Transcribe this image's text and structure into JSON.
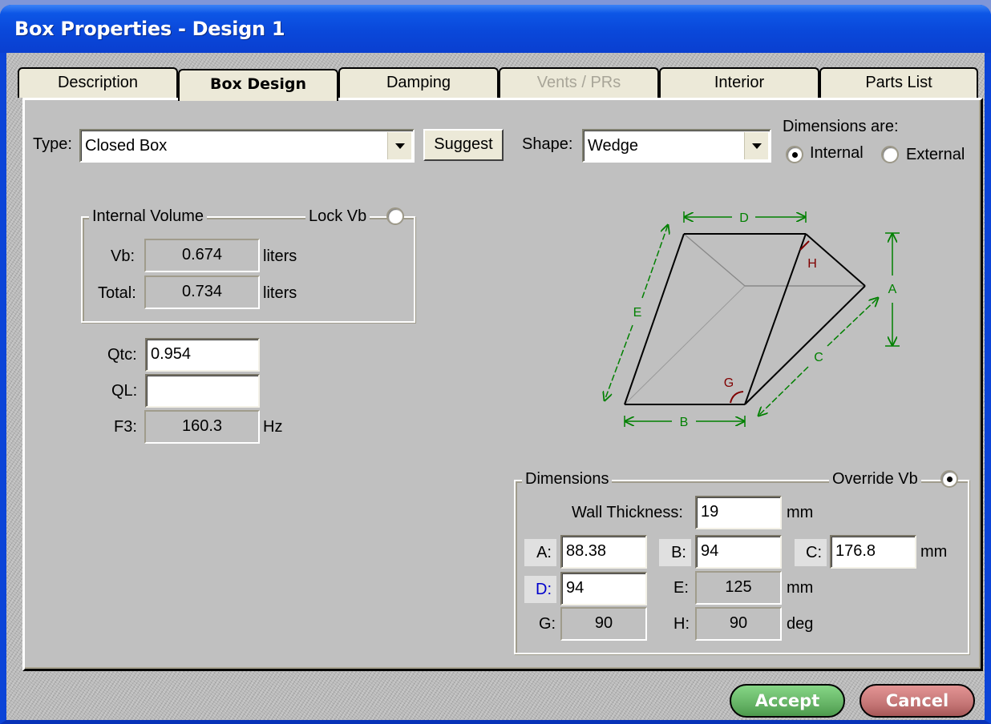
{
  "window": {
    "title": "Box Properties - Design 1"
  },
  "tabs": [
    {
      "label": "Description",
      "state": "normal"
    },
    {
      "label": "Box Design",
      "state": "active"
    },
    {
      "label": "Damping",
      "state": "normal"
    },
    {
      "label": "Vents / PRs",
      "state": "disabled"
    },
    {
      "label": "Interior",
      "state": "normal"
    },
    {
      "label": "Parts List",
      "state": "normal"
    }
  ],
  "box_design": {
    "type": {
      "label": "Type:",
      "value": "Closed Box"
    },
    "suggest_label": "Suggest",
    "shape": {
      "label": "Shape:",
      "value": "Wedge"
    },
    "dimensions_are": {
      "label": "Dimensions are:",
      "options": [
        {
          "label": "Internal",
          "selected": true
        },
        {
          "label": "External",
          "selected": false
        }
      ]
    },
    "internal_volume": {
      "title": "Internal Volume",
      "lock_label": "Lock Vb",
      "lock_checked": false,
      "rows": [
        {
          "label": "Vb:",
          "value": "0.674",
          "unit": "liters"
        },
        {
          "label": "Total:",
          "value": "0.734",
          "unit": "liters"
        }
      ]
    },
    "qtc": {
      "label": "Qtc:",
      "value": "0.954"
    },
    "ql": {
      "label": "QL:",
      "value": ""
    },
    "f3": {
      "label": "F3:",
      "value": "160.3",
      "unit": "Hz"
    }
  },
  "diagram": {
    "labels": {
      "A": "A",
      "B": "B",
      "C": "C",
      "D": "D",
      "E": "E",
      "G": "G",
      "H": "H"
    },
    "dimension_color": "#008000",
    "angle_color": "#800000"
  },
  "dimensions": {
    "title": "Dimensions",
    "override_label": "Override Vb",
    "override_checked": true,
    "wall_thickness": {
      "label": "Wall Thickness:",
      "value": "19",
      "unit": "mm"
    },
    "A": {
      "label": "A:",
      "value": "88.38"
    },
    "B": {
      "label": "B:",
      "value": "94"
    },
    "C": {
      "label": "C:",
      "value": "176.8"
    },
    "row1_unit": "mm",
    "D": {
      "label": "D:",
      "value": "94"
    },
    "E": {
      "label": "E:",
      "value": "125"
    },
    "row2_unit": "mm",
    "G": {
      "label": "G:",
      "value": "90"
    },
    "H": {
      "label": "H:",
      "value": "90"
    },
    "row3_unit": "deg"
  },
  "footer": {
    "accept_label": "Accept",
    "cancel_label": "Cancel"
  }
}
